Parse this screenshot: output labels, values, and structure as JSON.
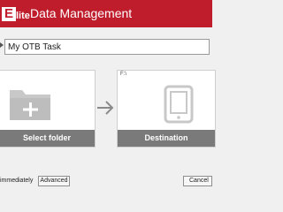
{
  "app": {
    "logo_letter": "E",
    "logo_rest": "lite",
    "title": "Data Management"
  },
  "task": {
    "name_value": "My OTB Task"
  },
  "source": {
    "label": "Select folder"
  },
  "destination": {
    "path": "F:\\",
    "label": "Destination"
  },
  "footer": {
    "immediately_label": "immediately",
    "advanced_label": "Advanced",
    "cancel_label": "Cancel"
  },
  "colors": {
    "brand": "#bf1c2c",
    "tile_label_bg": "#7a7a7a",
    "icon_gray": "#c8c8c8"
  }
}
